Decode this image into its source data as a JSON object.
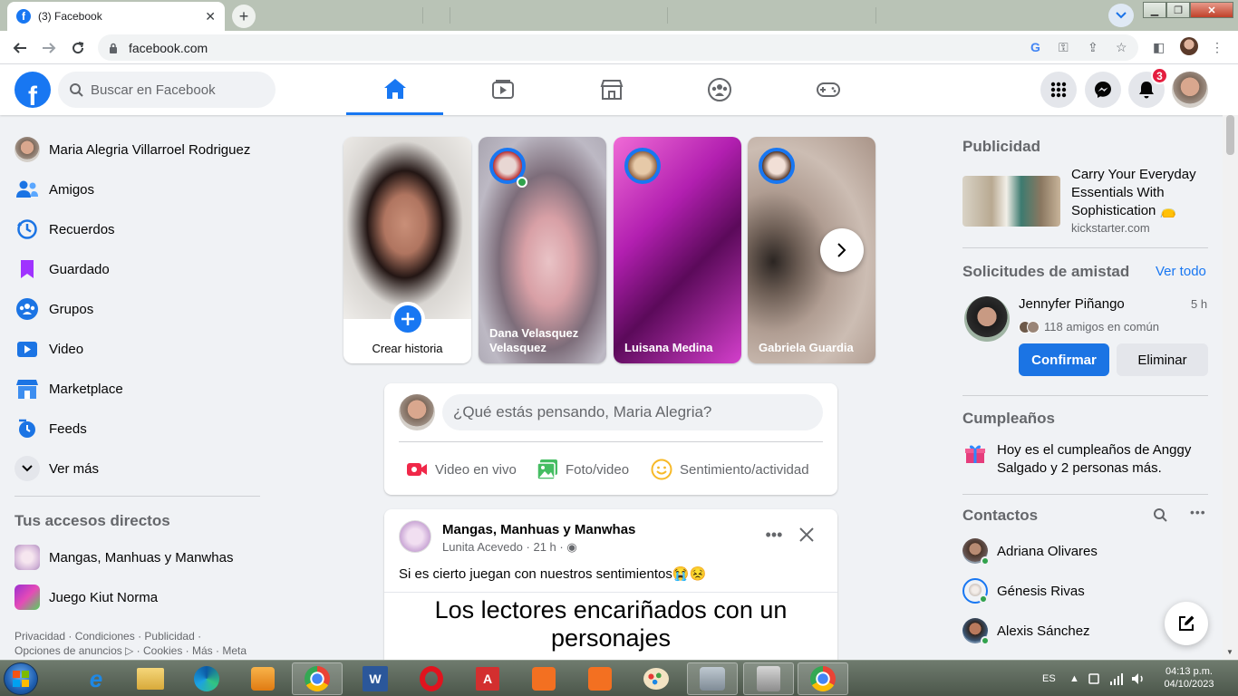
{
  "browser": {
    "tab_title": "(3) Facebook",
    "url": "facebook.com"
  },
  "fb": {
    "search_placeholder": "Buscar en Facebook",
    "notifications_count": "3"
  },
  "left_nav": {
    "items": [
      {
        "label": "Maria Alegria Villarroel Rodriguez",
        "icon": "profile-avatar"
      },
      {
        "label": "Amigos",
        "icon": "friends-icon"
      },
      {
        "label": "Recuerdos",
        "icon": "memories-icon"
      },
      {
        "label": "Guardado",
        "icon": "saved-icon"
      },
      {
        "label": "Grupos",
        "icon": "groups-icon"
      },
      {
        "label": "Video",
        "icon": "video-icon"
      },
      {
        "label": "Marketplace",
        "icon": "marketplace-icon"
      },
      {
        "label": "Feeds",
        "icon": "feeds-icon"
      },
      {
        "label": "Ver más",
        "icon": "chevron-down-icon"
      }
    ],
    "shortcuts_title": "Tus accesos directos",
    "shortcuts": [
      {
        "label": "Mangas, Manhuas y Manwhas"
      },
      {
        "label": "Juego Kiut Norma"
      }
    ],
    "footer_line1": "Privacidad · Condiciones · Publicidad ·",
    "footer_line2": "Opciones de anuncios ▷ · Cookies · Más · Meta"
  },
  "stories": {
    "create_label": "Crear historia",
    "items": [
      {
        "name": "Dana Velasquez Velasquez"
      },
      {
        "name": "Luisana Medina"
      },
      {
        "name": "Gabriela Guardia"
      }
    ]
  },
  "composer": {
    "placeholder": "¿Qué estás pensando, Maria Alegria?",
    "live_label": "Video en vivo",
    "photo_label": "Foto/video",
    "feeling_label": "Sentimiento/actividad"
  },
  "post": {
    "group_name": "Mangas, Manhuas y Manwhas",
    "author_meta": "Lunita Acevedo · 21 h · ",
    "text": "Si es cierto juegan con nuestros sentimientos😭😣",
    "image_text_line1": "Los lectores encariñados con un",
    "image_text_line2": "personajes"
  },
  "right": {
    "ads_title": "Publicidad",
    "ad_title": "Carry Your Everyday Essentials With Sophistication 👝",
    "ad_site": "kickstarter.com",
    "requests_title": "Solicitudes de amistad",
    "see_all": "Ver todo",
    "request_name": "Jennyfer Piñango",
    "request_time": "5 h",
    "request_mutual": "118 amigos en común",
    "confirm_label": "Confirmar",
    "delete_label": "Eliminar",
    "birthdays_title": "Cumpleaños",
    "birthday_prefix": "Hoy es el cumpleaños de ",
    "birthday_name": "Anggy Salgado",
    "birthday_mid": " y ",
    "birthday_others": "2 personas más",
    "birthday_end": ".",
    "contacts_title": "Contactos",
    "contacts": [
      {
        "name": "Adriana Olivares"
      },
      {
        "name": "Génesis Rivas"
      },
      {
        "name": "Alexis Sánchez"
      }
    ]
  },
  "taskbar": {
    "language": "ES",
    "time": "04:13 p.m.",
    "date": "04/10/2023"
  },
  "colors": {
    "fb_blue": "#1877f2",
    "online_green": "#31a24c",
    "badge_red": "#e41e3f"
  }
}
